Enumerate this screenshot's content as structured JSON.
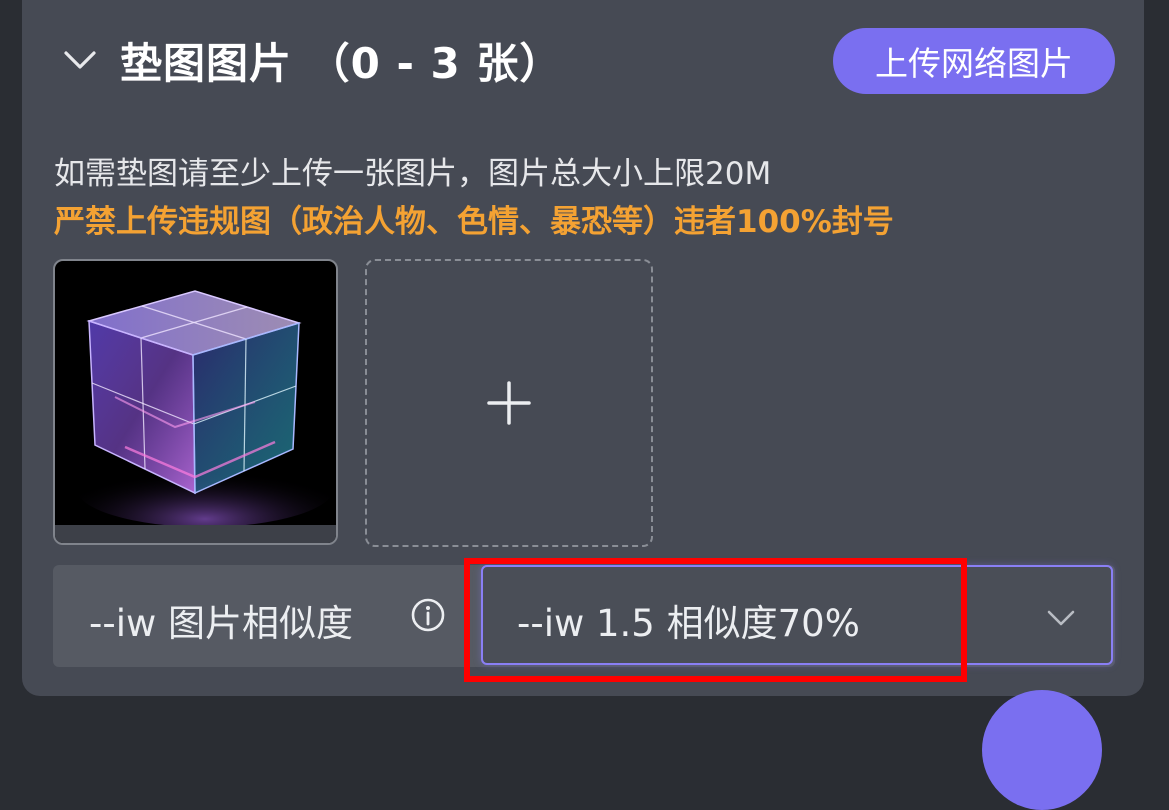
{
  "header": {
    "title": "垫图图片 （0 - 3 张）",
    "upload_network_button": "上传网络图片"
  },
  "notes": {
    "description": "如需垫图请至少上传一张图片，图片总大小上限20M",
    "warning": "严禁上传违规图（政治人物、色情、暴恐等）违者100%封号"
  },
  "images": {
    "uploaded_count": 1,
    "add_icon": "plus-icon"
  },
  "similarity": {
    "label": "--iw 图片相似度",
    "selected_value": "--iw 1.5 相似度70%",
    "info_icon": "info-icon",
    "dropdown_icon": "chevron-down-icon"
  },
  "colors": {
    "panel_bg": "#464a54",
    "accent": "#7a6ff0",
    "warning": "#f4a233",
    "highlight": "#ff0000"
  }
}
